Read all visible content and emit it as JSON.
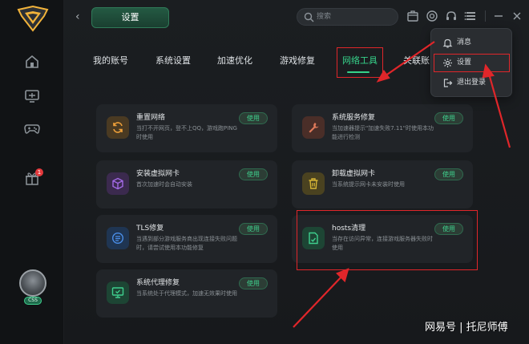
{
  "header": {
    "back_icon": "chevron-left-icon",
    "title": "设置",
    "search_placeholder": "搜索",
    "icons": [
      "store-icon",
      "headset-icon",
      "support-icon",
      "menu-icon",
      "minimize-icon",
      "close-icon"
    ]
  },
  "sidebar": {
    "items": [
      "home-icon",
      "monitor-icon",
      "gamepad-icon",
      "gift-icon"
    ],
    "notify_count": "1",
    "avatar_badge": "CSS"
  },
  "tabs": [
    {
      "label": "我的账号"
    },
    {
      "label": "系统设置"
    },
    {
      "label": "加速优化"
    },
    {
      "label": "游戏修复"
    },
    {
      "label": "网络工具",
      "active": true
    },
    {
      "label": "关联账"
    }
  ],
  "cards": [
    {
      "title": "重置网络",
      "desc": "当打不开网页，登不上QQ，游戏跑PING时使用",
      "button": "使用",
      "icon": "refresh-icon",
      "color": "#f0a13a"
    },
    {
      "title": "系统服务修复",
      "desc": "当加速器提示\"加速失败7.11\"时使用本功能进行检测",
      "button": "使用",
      "icon": "wrench-icon",
      "color": "#e07a5a"
    },
    {
      "title": "安装虚拟网卡",
      "desc": "首次加速时会自动安装",
      "button": "使用",
      "icon": "cube-icon",
      "color": "#a36ae6"
    },
    {
      "title": "卸载虚拟网卡",
      "desc": "当系统提示网卡未安装时使用",
      "button": "使用",
      "icon": "trash-icon",
      "color": "#d6b535"
    },
    {
      "title": "TLS修复",
      "desc": "当遇到部分游戏服务商出现连接失败问题时，请尝试使用本功能修复",
      "button": "使用",
      "icon": "list-icon",
      "color": "#4a8ee8"
    },
    {
      "title": "hosts清理",
      "desc": "当存在访问异常，连接游戏服务器失败时使用",
      "button": "使用",
      "icon": "file-icon",
      "color": "#3fcf8e"
    },
    {
      "title": "系统代理修复",
      "desc": "当系统处于代理模式，加速无效果时使用",
      "button": "使用",
      "icon": "monitor-check-icon",
      "color": "#3fcf8e"
    }
  ],
  "dropdown": {
    "items": [
      {
        "label": "消息",
        "icon": "bell-icon"
      },
      {
        "label": "设置",
        "icon": "gear-icon"
      },
      {
        "label": "退出登录",
        "icon": "logout-icon"
      }
    ]
  },
  "watermark": "网易号 | 托尼师傅",
  "colors": {
    "accent": "#36d28a",
    "annotation": "#e0262a",
    "background": "#17191c",
    "card": "#212428"
  }
}
